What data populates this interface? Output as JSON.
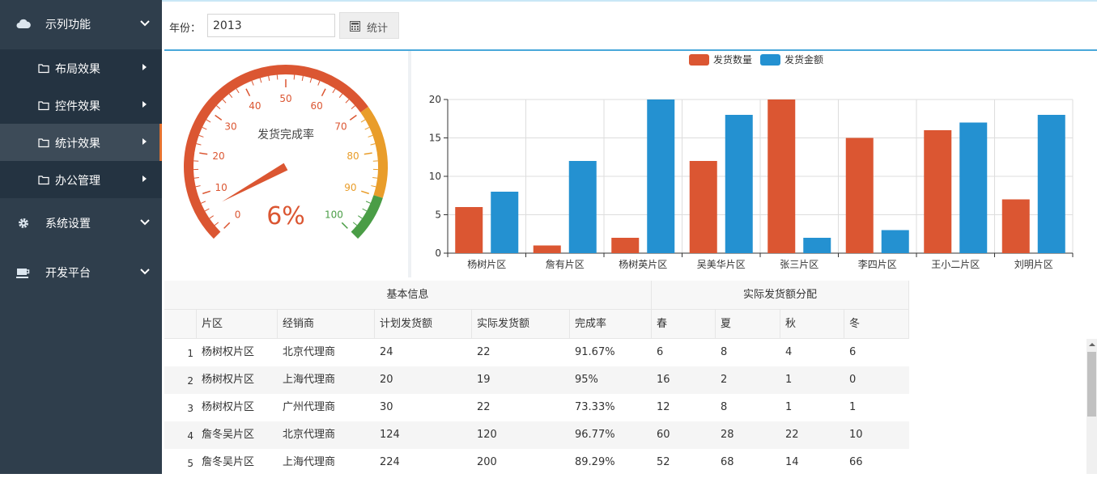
{
  "sidebar": {
    "groups": [
      {
        "label": "示列功能",
        "icon": "cloud-icon"
      },
      {
        "label": "系统设置",
        "icon": "gear-icon"
      },
      {
        "label": "开发平台",
        "icon": "coffee-icon"
      }
    ],
    "items": [
      {
        "label": "布局效果"
      },
      {
        "label": "控件效果"
      },
      {
        "label": "统计效果",
        "active": true
      },
      {
        "label": "办公管理"
      }
    ]
  },
  "toolbar": {
    "year_label": "年份：",
    "year_value": "2013",
    "stat_button": "统计",
    "stat_icon": "calculator-icon"
  },
  "gauge": {
    "title": "发货完成率",
    "value": 6,
    "value_text": "6%",
    "min": 0,
    "max": 100,
    "ticks": [
      "0",
      "10",
      "20",
      "30",
      "40",
      "50",
      "60",
      "70",
      "80",
      "90",
      "100"
    ],
    "colors": {
      "low": "#db5632",
      "mid": "#e99d2a",
      "high": "#4a9d46"
    }
  },
  "chart_data": {
    "type": "bar",
    "categories": [
      "杨树片区",
      "詹有片区",
      "杨树英片区",
      "吴美华片区",
      "张三片区",
      "李四片区",
      "王小二片区",
      "刘明片区"
    ],
    "series": [
      {
        "name": "发货数量",
        "color": "#db5632",
        "values": [
          6,
          1,
          2,
          12,
          20,
          15,
          16,
          7
        ]
      },
      {
        "name": "发货金额",
        "color": "#2491d1",
        "values": [
          8,
          12,
          20,
          18,
          2,
          3,
          17,
          18
        ]
      }
    ],
    "yticks": [
      "0",
      "5",
      "10",
      "15",
      "20"
    ],
    "ylim": [
      0,
      20
    ],
    "grid": true,
    "legend": "top-center"
  },
  "table": {
    "group_headers": [
      "基本信息",
      "实际发货额分配"
    ],
    "columns": [
      "片区",
      "经销商",
      "计划发货额",
      "实际发货额",
      "完成率",
      "春",
      "夏",
      "秋",
      "冬"
    ],
    "rows": [
      {
        "n": "1",
        "c": [
          "杨树权片区",
          "北京代理商",
          "24",
          "22",
          "91.67%",
          "6",
          "8",
          "4",
          "6"
        ]
      },
      {
        "n": "2",
        "c": [
          "杨树权片区",
          "上海代理商",
          "20",
          "19",
          "95%",
          "16",
          "2",
          "1",
          "0"
        ]
      },
      {
        "n": "3",
        "c": [
          "杨树权片区",
          "广州代理商",
          "30",
          "22",
          "73.33%",
          "12",
          "8",
          "1",
          "1"
        ]
      },
      {
        "n": "4",
        "c": [
          "詹冬吴片区",
          "北京代理商",
          "124",
          "120",
          "96.77%",
          "60",
          "28",
          "22",
          "10"
        ]
      },
      {
        "n": "5",
        "c": [
          "詹冬吴片区",
          "上海代理商",
          "224",
          "200",
          "89.29%",
          "52",
          "68",
          "14",
          "66"
        ]
      }
    ]
  }
}
